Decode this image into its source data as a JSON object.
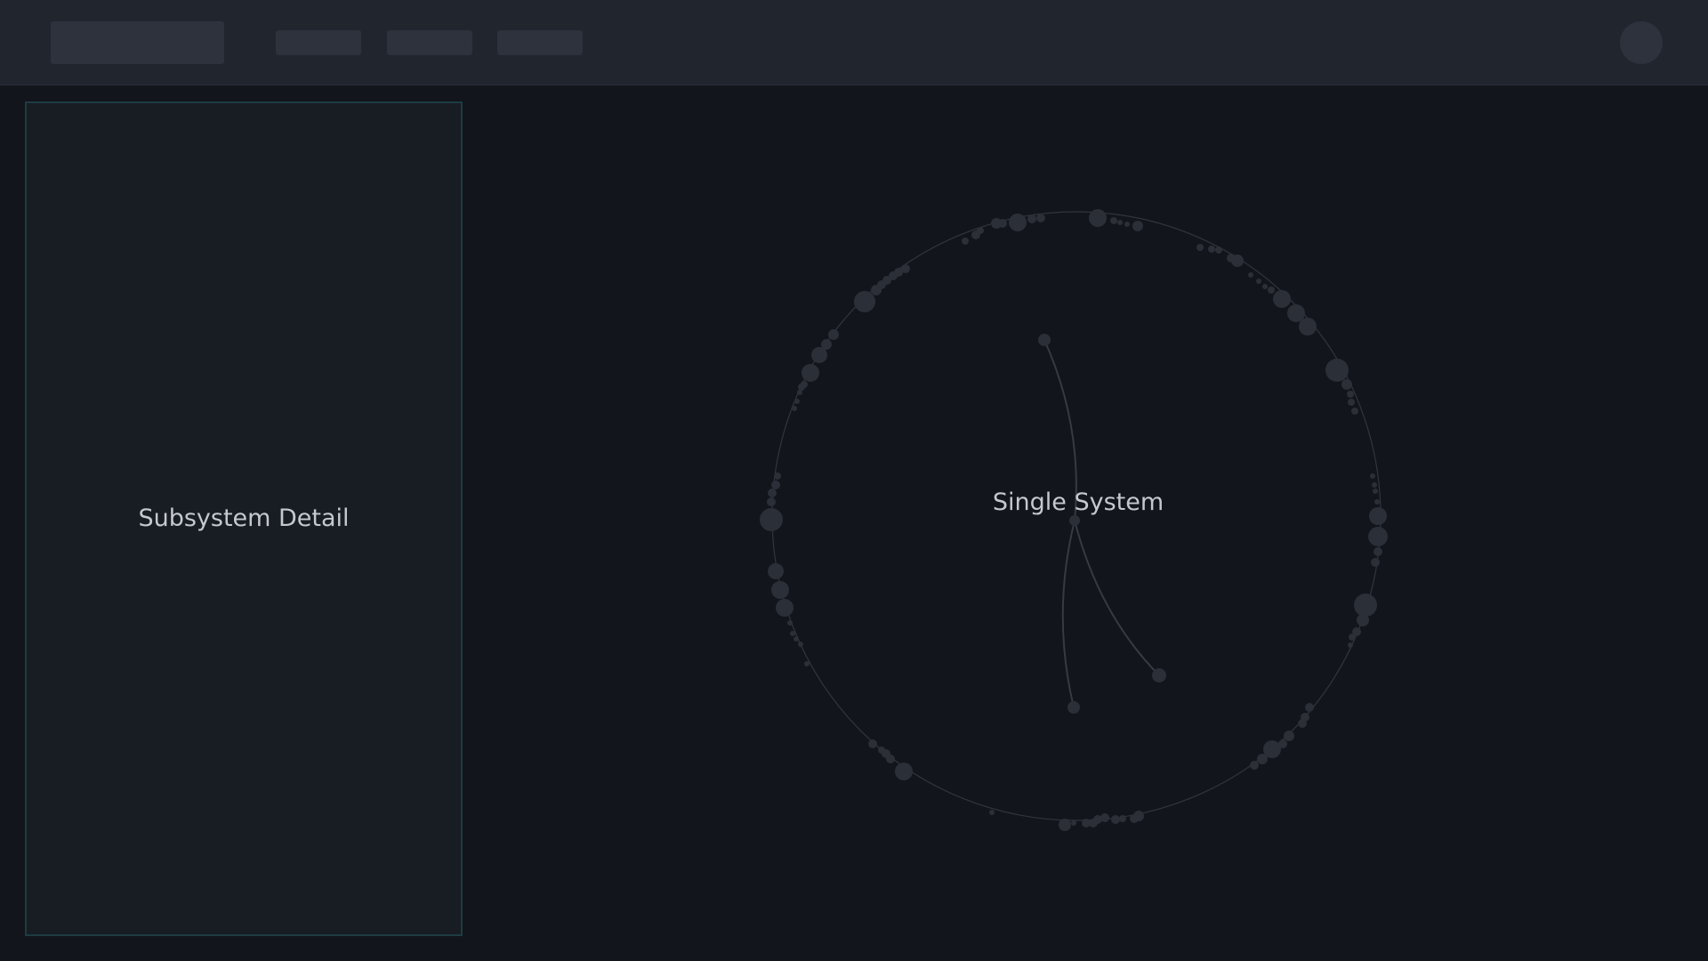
{
  "detail_panel": {
    "title": "Subsystem Detail"
  },
  "graph": {
    "center_label": "Single System"
  },
  "colors": {
    "background": "#12151b",
    "topbar": "#21252e",
    "placeholder": "#2d323d",
    "panel": "#181c23",
    "panel_border": "#1d3c42",
    "node": "#2b2f38",
    "edge": "#353a44",
    "text": "#c4c8cf"
  },
  "icons": [
    "logo-placeholder",
    "avatar-icon"
  ]
}
